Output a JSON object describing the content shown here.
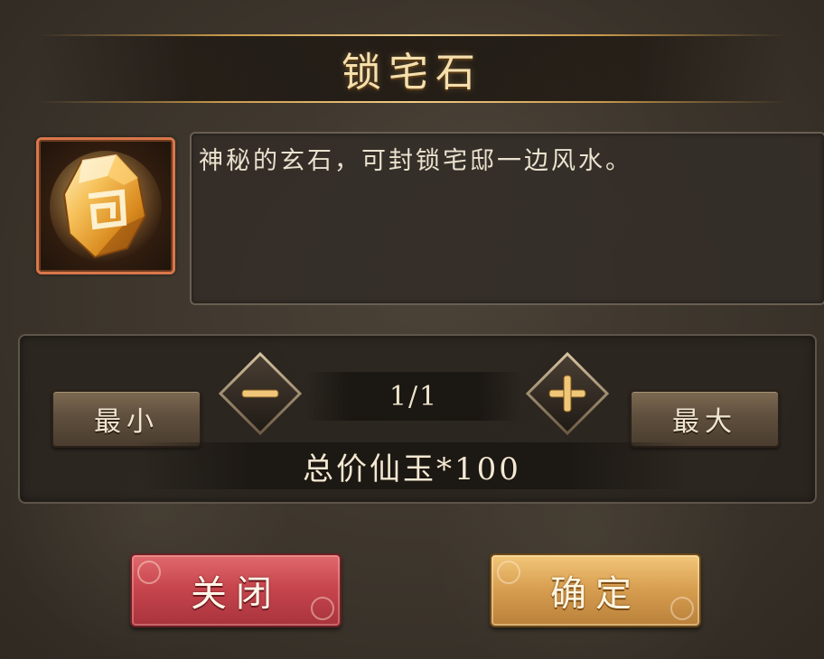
{
  "dialog": {
    "title": "锁宅石",
    "item_icon": "amber-stone-icon",
    "description": "神秘的玄石，可封锁宅邸一边风水。"
  },
  "quantity": {
    "min_label": "最小",
    "max_label": "最大",
    "minus_icon": "minus-icon",
    "plus_icon": "plus-icon",
    "value": "1/1",
    "total": "总价仙玉*100"
  },
  "buttons": {
    "close_label": "关闭",
    "confirm_label": "确定"
  },
  "colors": {
    "accent_gold": "#f5dfac",
    "close_red": "#c8464e",
    "confirm_gold": "#d9a052",
    "item_border": "#d9774a"
  }
}
